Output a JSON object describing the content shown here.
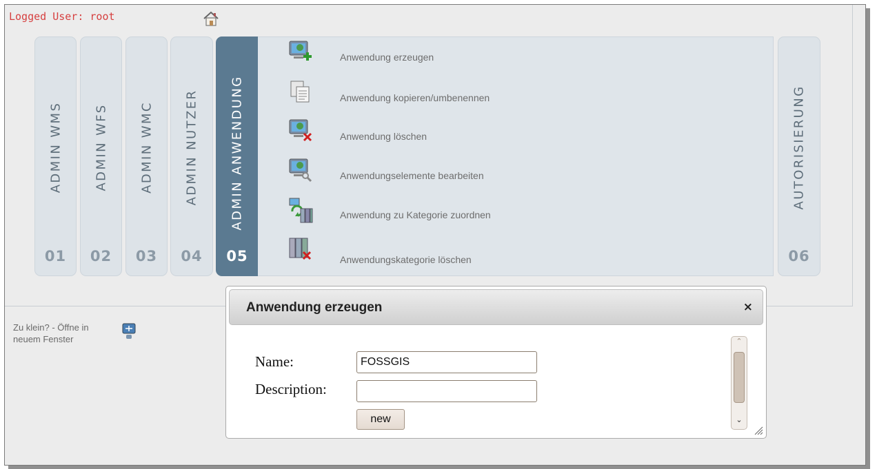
{
  "header": {
    "logged_user": "Logged User: root",
    "home_icon": "home-icon"
  },
  "tabs": [
    {
      "label": "ADMIN WMS",
      "number": "01"
    },
    {
      "label": "ADMIN WFS",
      "number": "02"
    },
    {
      "label": "ADMIN WMC",
      "number": "03"
    },
    {
      "label": "ADMIN NUTZER",
      "number": "04"
    },
    {
      "label": "ADMIN ANWENDUNG",
      "number": "05",
      "active": true
    },
    {
      "label": "AUTORISIERUNG",
      "number": "06"
    }
  ],
  "menu": [
    {
      "label": "Anwendung erzeugen",
      "icon": "application-add-icon"
    },
    {
      "label": "Anwendung kopieren/umbenennen",
      "icon": "copy-icon"
    },
    {
      "label": "Anwendung löschen",
      "icon": "application-delete-icon"
    },
    {
      "label": "Anwendungselemente bearbeiten",
      "icon": "application-edit-icon"
    },
    {
      "label": "Anwendung zu Kategorie zuordnen",
      "icon": "assign-category-icon"
    },
    {
      "label": "Anwendungskategorie löschen",
      "icon": "category-delete-icon"
    }
  ],
  "sidebar": {
    "small_text": "Zu klein? - Öffne in neuem Fenster",
    "icon": "new-window-icon"
  },
  "dialog": {
    "title": "Anwendung erzeugen",
    "close_label": "×",
    "name_label": "Name:",
    "name_value": "FOSSGIS",
    "description_label": "Description:",
    "description_value": "",
    "button_label": "new"
  },
  "colors": {
    "active_tab": "#5b7a91",
    "inactive_tab": "#dde3e8",
    "user_text": "#d64040"
  }
}
